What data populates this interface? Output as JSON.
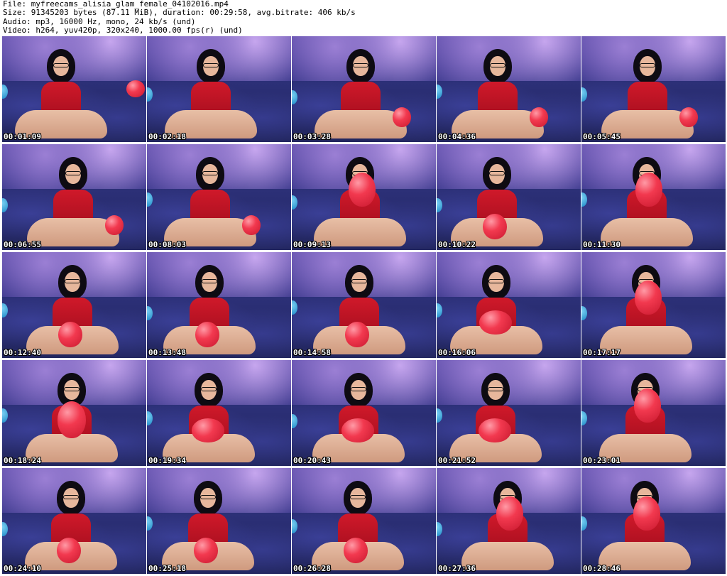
{
  "header": {
    "file_line": "File: myfreecams_alisia_glam_female_04102016.mp4",
    "size_line": "Size: 91345203 bytes (87.11 MiB), duration: 00:29:58, avg.bitrate: 406 kb/s",
    "audio_line": "Audio: mp3, 16000 Hz, mono, 24 kb/s (und)",
    "video_line": "Video: h264, yuv420p, 320x240, 1000.00 fps(r) (und)"
  },
  "colors": {
    "background": "#ffffff",
    "timestamp_text": "#ffffff",
    "timestamp_outline": "#000000",
    "dress": "#d0192a",
    "balloon": "#f2394f"
  },
  "thumbnails": [
    {
      "timestamp": "00:01:09",
      "balloon": "right",
      "pose": "lean"
    },
    {
      "timestamp": "00:02:18",
      "balloon": "none",
      "pose": "knees"
    },
    {
      "timestamp": "00:03:28",
      "balloon": "right-low",
      "pose": "sit"
    },
    {
      "timestamp": "00:04:36",
      "balloon": "right-low",
      "pose": "sit"
    },
    {
      "timestamp": "00:05:45",
      "balloon": "right-low",
      "pose": "sit"
    },
    {
      "timestamp": "00:06:55",
      "balloon": "right-low",
      "pose": "lean"
    },
    {
      "timestamp": "00:08:03",
      "balloon": "right-low",
      "pose": "sit"
    },
    {
      "timestamp": "00:09:13",
      "balloon": "face",
      "pose": "sit"
    },
    {
      "timestamp": "00:10:22",
      "balloon": "lap",
      "pose": "sit"
    },
    {
      "timestamp": "00:11:30",
      "balloon": "face",
      "pose": "sit"
    },
    {
      "timestamp": "00:12:40",
      "balloon": "lap",
      "pose": "sit"
    },
    {
      "timestamp": "00:13:48",
      "balloon": "lap",
      "pose": "sit"
    },
    {
      "timestamp": "00:14:58",
      "balloon": "lap",
      "pose": "sit"
    },
    {
      "timestamp": "00:16:06",
      "balloon": "chest",
      "pose": "sit"
    },
    {
      "timestamp": "00:17:17",
      "balloon": "face",
      "pose": "sit"
    },
    {
      "timestamp": "00:18:24",
      "balloon": "big-left",
      "pose": "sit"
    },
    {
      "timestamp": "00:19:34",
      "balloon": "chest",
      "pose": "sit"
    },
    {
      "timestamp": "00:20:43",
      "balloon": "chest",
      "pose": "sit"
    },
    {
      "timestamp": "00:21:52",
      "balloon": "chest",
      "pose": "sit"
    },
    {
      "timestamp": "00:23:01",
      "balloon": "face",
      "pose": "sit"
    },
    {
      "timestamp": "00:24:10",
      "balloon": "lap",
      "pose": "sit"
    },
    {
      "timestamp": "00:25:18",
      "balloon": "lap",
      "pose": "sit"
    },
    {
      "timestamp": "00:26:28",
      "balloon": "lap",
      "pose": "sit"
    },
    {
      "timestamp": "00:27:36",
      "balloon": "face",
      "pose": "sit"
    },
    {
      "timestamp": "00:28:46",
      "balloon": "face",
      "pose": "sit"
    }
  ]
}
